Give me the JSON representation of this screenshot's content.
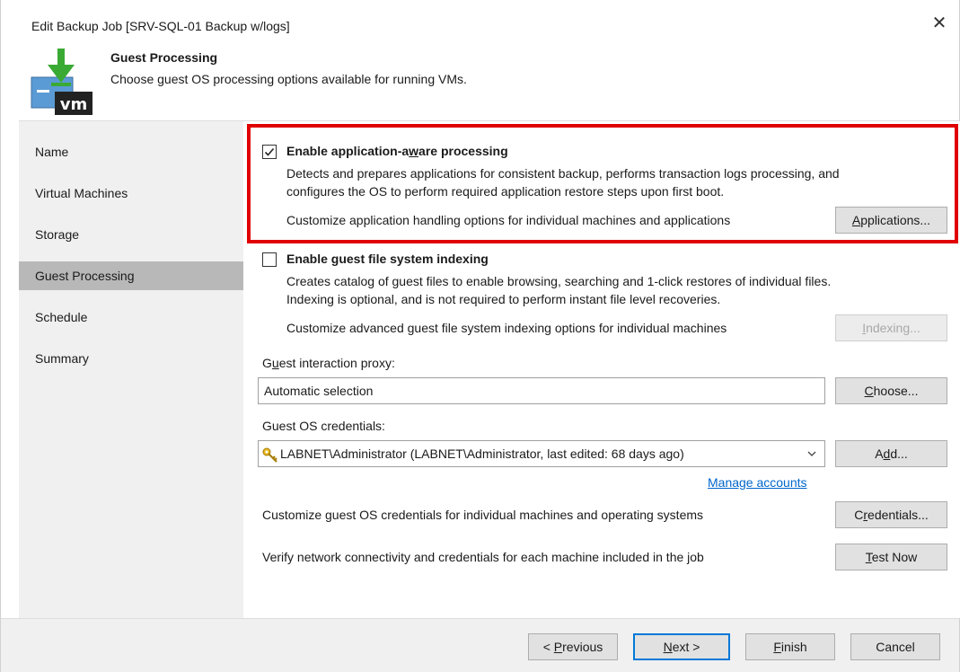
{
  "window": {
    "title": "Edit Backup Job [SRV-SQL-01 Backup w/logs]",
    "close_glyph": "✕"
  },
  "header": {
    "title": "Guest Processing",
    "subtitle": "Choose guest OS processing options available for running VMs.",
    "logo_text": "vm",
    "logo_icon": "vm-backup-icon"
  },
  "sidebar": {
    "items": [
      {
        "label": "Name"
      },
      {
        "label": "Virtual Machines"
      },
      {
        "label": "Storage"
      },
      {
        "label": "Guest Processing",
        "active": true
      },
      {
        "label": "Schedule"
      },
      {
        "label": "Summary"
      }
    ]
  },
  "app_aware": {
    "checked": true,
    "label_pre": "Enable application-a",
    "label_ul": "w",
    "label_post": "are processing",
    "desc_line1": "Detects and prepares applications for consistent backup, performs transaction logs processing, and",
    "desc_line2": "configures the OS to perform required application restore steps upon first boot.",
    "customize_text": "Customize application handling options for individual machines and applications",
    "button_ul": "A",
    "button_rest": "pplications..."
  },
  "indexing": {
    "checked": false,
    "label": "Enable guest file system indexing",
    "desc_line1": "Creates catalog of guest files to enable browsing, searching and 1-click restores of individual files.",
    "desc_line2": "Indexing is optional, and is not required to perform instant file level recoveries.",
    "customize_text": "Customize advanced guest file system indexing options for individual machines",
    "button_ul": "I",
    "button_rest": "ndexing..."
  },
  "proxy": {
    "label_pre": "G",
    "label_ul": "u",
    "label_post": "est interaction proxy:",
    "value": "Automatic selection",
    "button_ul": "C",
    "button_rest": "hoose..."
  },
  "credentials": {
    "label": "Guest OS credentials:",
    "value": "LABNET\\Administrator (LABNET\\Administrator, last edited: 68 days ago)",
    "add_pre": "A",
    "add_ul": "d",
    "add_post": "d...",
    "manage_link": "Manage accounts",
    "customize_text": "Customize guest OS credentials for individual machines and operating systems",
    "cred_pre": "C",
    "cred_ul": "r",
    "cred_post": "edentials...",
    "verify_text": "Verify network connectivity and credentials for each machine included in the job",
    "test_ul": "T",
    "test_rest": "est Now"
  },
  "footer": {
    "prev_pre": "< ",
    "prev_ul": "P",
    "prev_post": "revious",
    "next_ul": "N",
    "next_post": "ext >",
    "finish_ul": "F",
    "finish_post": "inish",
    "cancel": "Cancel"
  },
  "colors": {
    "highlight_border": "#e00000",
    "sidebar_bg": "#f0f0f0",
    "sidebar_active": "#b8b8b8",
    "link": "#0066cc",
    "logo_green": "#3aaa35"
  }
}
